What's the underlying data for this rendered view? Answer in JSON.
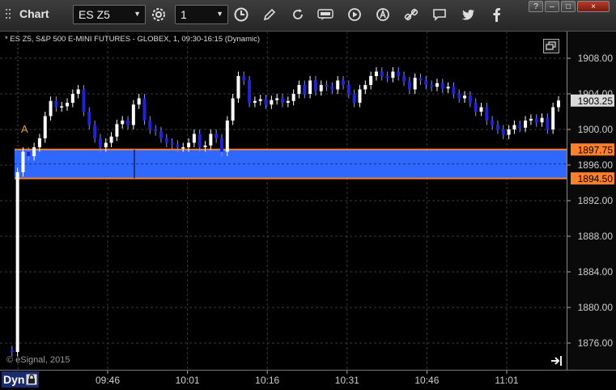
{
  "toolbar": {
    "title": "Chart",
    "symbol": "ES Z5",
    "interval": "1",
    "icons": [
      "gear-icon",
      "clock-icon",
      "pencil-icon",
      "refresh-icon",
      "get-icon",
      "play-icon",
      "alert-icon",
      "link-icon",
      "comment-icon",
      "twitter-icon",
      "facebook-icon"
    ]
  },
  "window_controls": {
    "help": "?",
    "minimize": "–",
    "maximize": "□",
    "close": "×"
  },
  "chart": {
    "header": "* ES Z5, S&P 500 E-MINI FUTURES - GLOBEX, 1, 09:30-16:15 (Dynamic)",
    "marker": "A",
    "copyright": "© eSignal, 2015",
    "dyn_label": "Dyn",
    "colors": {
      "up": "#ffffff",
      "down": "#1e23d6",
      "band": "#2f68ff",
      "band_border": "#ff7f2a",
      "grid": "#3a3a3a"
    }
  },
  "price_axis": {
    "ticks": [
      "1908.00",
      "1904.00",
      "1900.00",
      "1896.00",
      "1892.00",
      "1888.00",
      "1884.00",
      "1880.00",
      "1876.00"
    ],
    "last_price": "1903.25",
    "band_top": "1897.75",
    "band_bottom": "1894.50"
  },
  "time_axis": {
    "ticks": [
      "09:46",
      "10:01",
      "10:16",
      "10:31",
      "10:46",
      "11:01"
    ]
  },
  "chart_data": {
    "type": "candlestick",
    "x_ticks": [
      "09:46",
      "10:01",
      "10:16",
      "10:31",
      "10:46",
      "11:01"
    ],
    "ylim": [
      1873,
      1911
    ],
    "y_ticks": [
      1908,
      1904,
      1900,
      1896,
      1892,
      1888,
      1884,
      1880,
      1876
    ],
    "last_price": 1903.25,
    "band": [
      1894.5,
      1897.75
    ],
    "closes": [
      1875.2,
      1875.0,
      1895.2,
      1897.5,
      1897.0,
      1898.0,
      1899.0,
      1901.5,
      1903.2,
      1902.5,
      1902.6,
      1903.0,
      1904.0,
      1904.5,
      1902.0,
      1900.5,
      1899.0,
      1898.0,
      1898.5,
      1899.2,
      1900.6,
      1901.0,
      1900.5,
      1902.8,
      1903.5,
      1901.0,
      1900.0,
      1899.8,
      1899.0,
      1898.5,
      1898.3,
      1898.0,
      1898.0,
      1898.5,
      1899.5,
      1898.0,
      1898.2,
      1899.5,
      1899.0,
      1897.5,
      1901.0,
      1903.5,
      1906.0,
      1905.5,
      1903.0,
      1903.2,
      1903.4,
      1902.8,
      1903.3,
      1903.5,
      1903.0,
      1903.2,
      1904.0,
      1905.0,
      1904.0,
      1905.5,
      1904.3,
      1905.0,
      1904.8,
      1904.5,
      1905.5,
      1905.0,
      1904.0,
      1903.0,
      1904.5,
      1905.0,
      1906.0,
      1906.5,
      1906.0,
      1905.8,
      1906.5,
      1906.0,
      1905.4,
      1904.5,
      1905.8,
      1905.5,
      1905.0,
      1904.8,
      1905.2,
      1904.6,
      1904.8,
      1904.0,
      1903.5,
      1903.8,
      1903.0,
      1902.0,
      1902.5,
      1901.0,
      1900.5,
      1900.0,
      1899.4,
      1900.0,
      1900.5,
      1900.2,
      1901.0,
      1901.2,
      1900.8,
      1901.3,
      1900.0,
      1902.5,
      1903.25
    ]
  }
}
